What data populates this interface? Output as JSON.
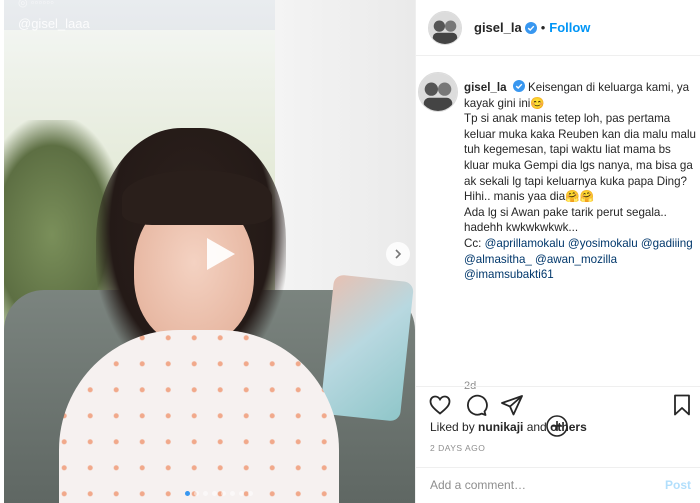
{
  "media": {
    "watermark": "@gisel_laaa",
    "watermark_top": "◎ ◦◦◦◦◦◦",
    "carousel": {
      "total": 8,
      "active_index": 0
    },
    "play_icon": "play-icon",
    "next_icon": "chevron-right-icon"
  },
  "header": {
    "username": "gisel_la",
    "separator": "•",
    "follow_label": "Follow"
  },
  "caption": {
    "username": "gisel_la",
    "line1": "Keisengan di keluarga kami, ya kayak gini ini😊",
    "line2": "Tp si anak manis tetep loh, pas pertama keluar muka kaka Reuben kan dia malu malu tuh kegemesan, tapi waktu liat mama bs kluar muka Gempi dia lgs nanya, ma bisa ga ak sekali lg tapi keluarnya kuka papa Ding? Hihi.. manis yaa dia🤗🤗",
    "line3": "Ada lg si Awan pake tarik perut segala.. hadehh kwkwkwkwk...",
    "line4_prefix": "Cc: ",
    "tags": "@aprillamokalu @yosimokalu @gadiiing @almasitha_ @awan_mozilla @imamsubakti61",
    "time_relative": "2d"
  },
  "actions": {
    "icons": [
      "heart-icon",
      "comment-icon",
      "share-icon",
      "bookmark-icon"
    ]
  },
  "likes": {
    "prefix": "Liked by ",
    "user": "nunikaji",
    "middle": " and ",
    "others": "others"
  },
  "date": "2 DAYS AGO",
  "comment": {
    "placeholder": "Add a comment…",
    "post_label": "Post"
  },
  "colors": {
    "accent": "#0095f6",
    "post_disabled": "#b2dffc",
    "muted": "#8e8e8e"
  }
}
